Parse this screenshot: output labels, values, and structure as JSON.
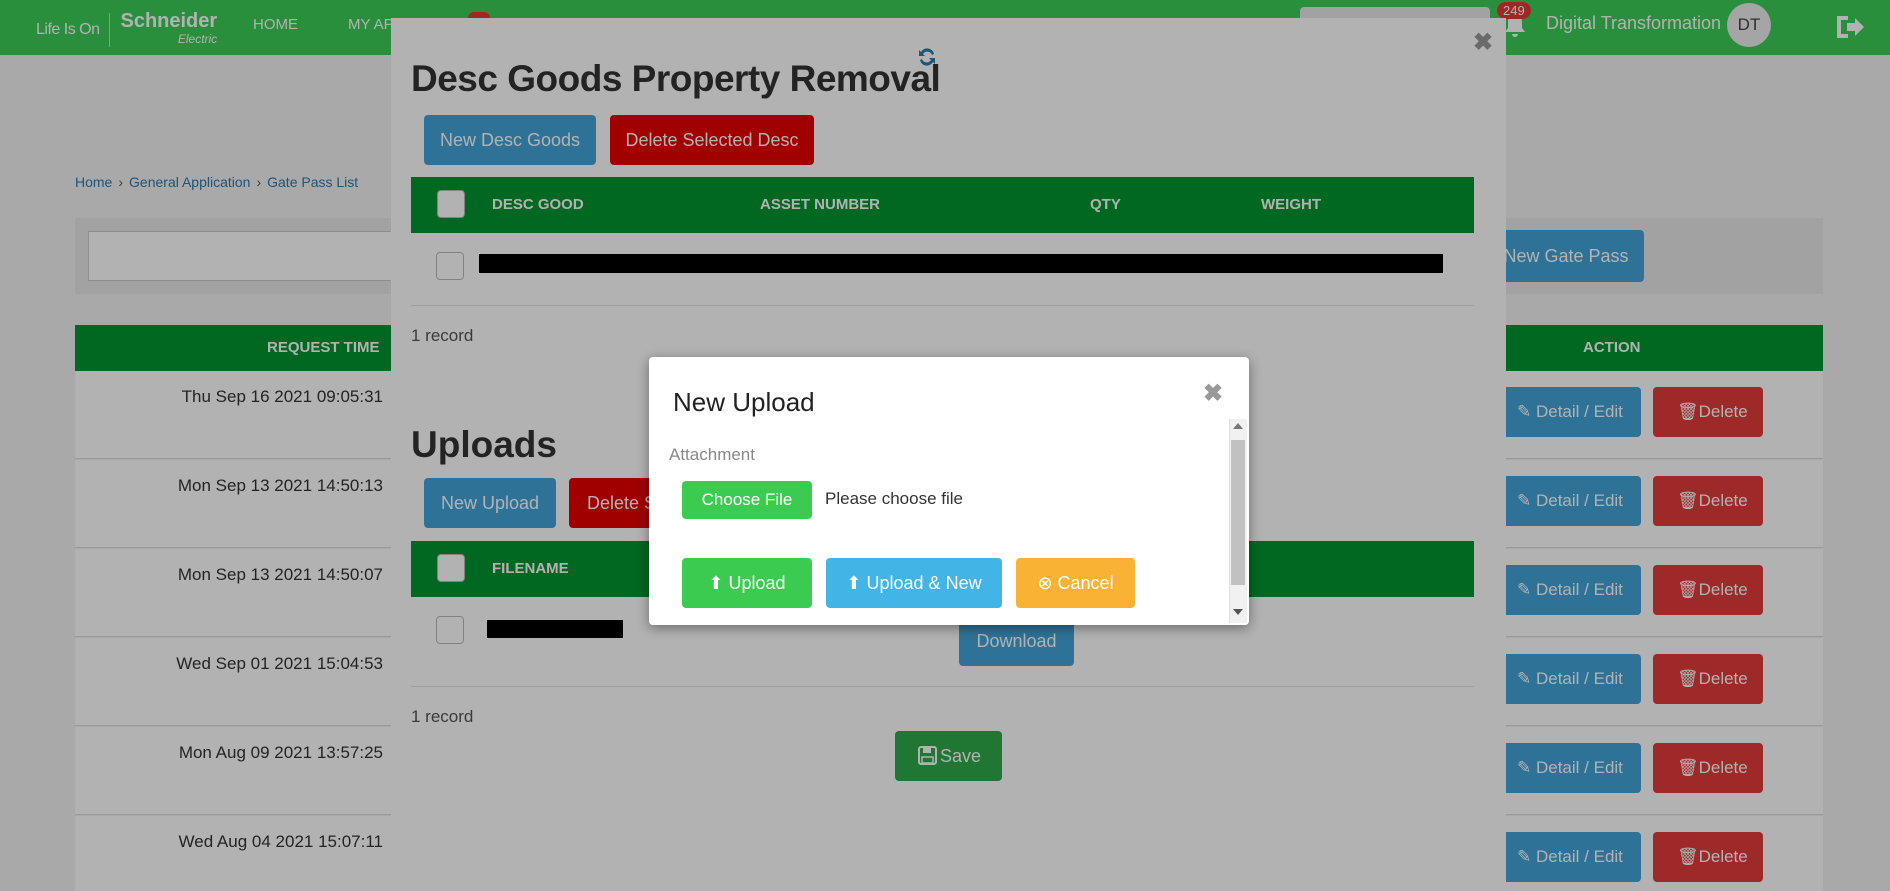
{
  "topbar": {
    "logo_tagline": "Life Is On",
    "logo_brand": "Schneider",
    "logo_sub": "Electric",
    "nav": [
      "HOME",
      "MY AP"
    ],
    "notification_count": "249",
    "user_name": "Digital Transformation",
    "avatar_initials": "DT"
  },
  "breadcrumb": [
    "Home",
    "General Application",
    "Gate Pass List"
  ],
  "page": {
    "new_gate_pass_label": "New Gate Pass",
    "col_request_time": "REQUEST TIME",
    "col_action": "ACTION",
    "detail_label": "Detail / Edit",
    "delete_label": "Delete",
    "rows": [
      {
        "time": "Thu Sep 16 2021 09:05:31"
      },
      {
        "time": "Mon Sep 13 2021 14:50:13"
      },
      {
        "time": "Mon Sep 13 2021 14:50:07"
      },
      {
        "time": "Wed Sep 01 2021 15:04:53"
      },
      {
        "time": "Mon Aug 09 2021 13:57:25"
      },
      {
        "time": "Wed Aug 04 2021 15:07:11"
      }
    ]
  },
  "modal": {
    "title": "Desc Goods Property Removal",
    "new_desc_label": "New Desc Goods",
    "delete_desc_label": "Delete Selected Desc",
    "columns": [
      "DESC GOOD",
      "ASSET NUMBER",
      "QTY",
      "WEIGHT"
    ],
    "desc_record_count": "1 record",
    "uploads_title": "Uploads",
    "new_upload_label": "New Upload",
    "delete_upload_label": "Delete S",
    "upload_columns": [
      "FILENAME"
    ],
    "download_label": "Download",
    "upload_record_count": "1 record",
    "save_label": "Save"
  },
  "upload_dialog": {
    "title": "New Upload",
    "attachment_label": "Attachment",
    "choose_file_label": "Choose File",
    "file_status": "Please choose file",
    "upload_label": "Upload",
    "upload_new_label": "Upload & New",
    "cancel_label": "Cancel"
  },
  "colors": {
    "brand_green": "#3dcd58",
    "table_green": "#009530",
    "primary_blue": "#42a5d8",
    "danger_red": "#e33b3b",
    "warning_orange": "#f9b233"
  }
}
